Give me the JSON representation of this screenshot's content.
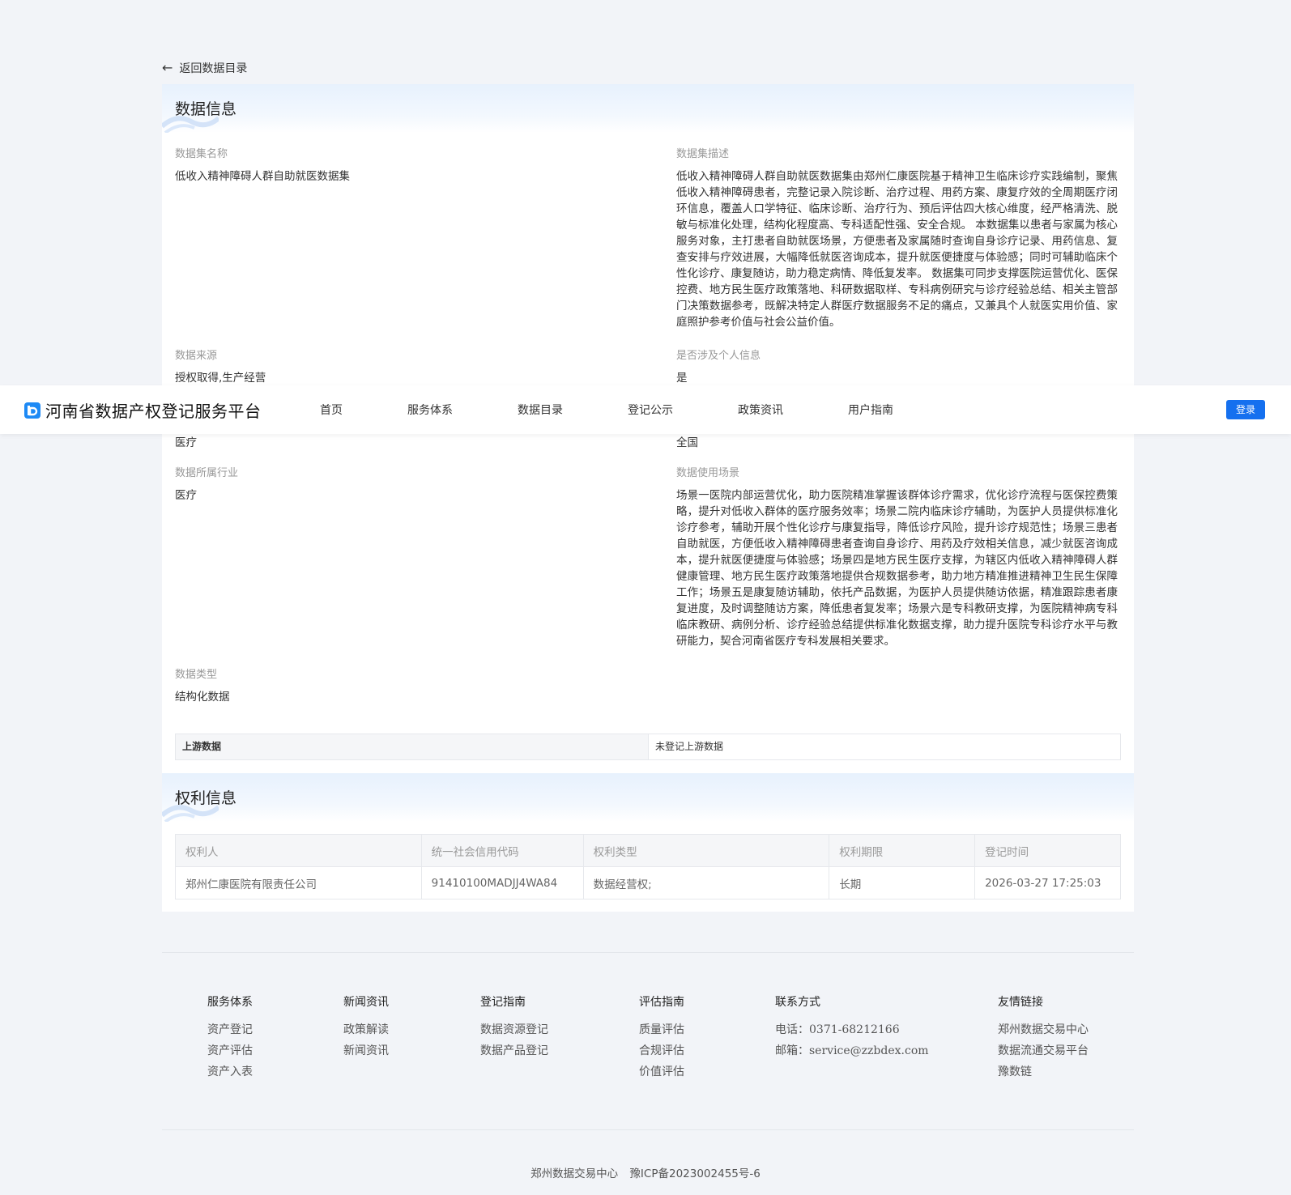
{
  "back": {
    "label": "返回数据目录"
  },
  "data_info": {
    "title": "数据信息",
    "dataset_name": {
      "label": "数据集名称",
      "value": "低收入精神障碍人群自助就医数据集"
    },
    "dataset_desc": {
      "label": "数据集描述",
      "value": "低收入精神障碍人群自助就医数据集由郑州仁康医院基于精神卫生临床诊疗实践编制，聚焦低收入精神障碍患者，完整记录入院诊断、治疗过程、用药方案、康复疗效的全周期医疗闭环信息，覆盖人口学特征、临床诊断、治疗行为、预后评估四大核心维度，经严格清洗、脱敏与标准化处理，结构化程度高、专科适配性强、安全合规。 本数据集以患者与家属为核心服务对象，主打患者自助就医场景，方便患者及家属随时查询自身诊疗记录、用药信息、复查安排与疗效进展，大幅降低就医咨询成本，提升就医便捷度与体验感；同时可辅助临床个性化诊疗、康复随访，助力稳定病情、降低复发率。 数据集可同步支撑医院运营优化、医保控费、地方民生医疗政策落地、科研数据取样、专科病例研究与诊疗经验总结、相关主管部门决策数据参考，既解决特定人群医疗数据服务不足的痛点，又兼具个人就医实用价值、家庭照护参考价值与社会公益价值。"
    },
    "data_source": {
      "label": "数据来源",
      "value": "授权取得,生产经营"
    },
    "personal_info": {
      "label": "是否涉及个人信息",
      "value": "是"
    },
    "domain": {
      "value": "医疗"
    },
    "region": {
      "value": "全国"
    },
    "industry": {
      "label": "数据所属行业",
      "value": "医疗"
    },
    "scenario": {
      "label": "数据使用场景",
      "value": "场景一医院内部运营优化，助力医院精准掌握该群体诊疗需求，优化诊疗流程与医保控费策略，提升对低收入群体的医疗服务效率；场景二院内临床诊疗辅助，为医护人员提供标准化诊疗参考，辅助开展个性化诊疗与康复指导，降低诊疗风险，提升诊疗规范性；场景三患者自助就医，方便低收入精神障碍患者查询自身诊疗、用药及疗效相关信息，减少就医咨询成本，提升就医便捷度与体验感；场景四是地方民生医疗支撑，为辖区内低收入精神障碍人群健康管理、地方民生医疗政策落地提供合规数据参考，助力地方精准推进精神卫生民生保障工作；场景五是康复随访辅助，依托产品数据，为医护人员提供随访依据，精准跟踪患者康复进度，及时调整随访方案，降低患者复发率；场景六是专科教研支撑，为医院精神病专科临床教研、病例分析、诊疗经验总结提供标准化数据支撑，助力提升医院专科诊疗水平与教研能力，契合河南省医疗专科发展相关要求。"
    },
    "data_type": {
      "label": "数据类型",
      "value": "结构化数据"
    },
    "upstream": {
      "label": "上游数据",
      "value": "未登记上游数据"
    }
  },
  "rights_info": {
    "title": "权利信息",
    "columns": [
      "权利人",
      "统一社会信用代码",
      "权利类型",
      "权利期限",
      "登记时间"
    ],
    "rows": [
      [
        "郑州仁康医院有限责任公司",
        "91410100MADJJ4WA84",
        "数据经营权;",
        "长期",
        "2026-03-27 17:25:03"
      ]
    ]
  },
  "navbar": {
    "brand": "河南省数据产权登记服务平台",
    "items": [
      "首页",
      "服务体系",
      "数据目录",
      "登记公示",
      "政策资讯",
      "用户指南"
    ],
    "login": "登录",
    "accent": "#1570ef"
  },
  "footer": {
    "services": {
      "title": "服务体系",
      "items": [
        "资产登记",
        "资产评估",
        "资产入表"
      ]
    },
    "news": {
      "title": "新闻资讯",
      "items": [
        "政策解读",
        "新闻资讯"
      ]
    },
    "registration": {
      "title": "登记指南",
      "items": [
        "数据资源登记",
        "数据产品登记"
      ]
    },
    "evaluation": {
      "title": "评估指南",
      "items": [
        "质量评估",
        "合规评估",
        "价值评估"
      ]
    },
    "contact": {
      "title": "联系方式",
      "phone": "电话：0371-68212166",
      "email": "邮箱：service@zzbdex.com"
    },
    "links": {
      "title": "友情链接",
      "items": [
        "郑州数据交易中心",
        "数据流通交易平台",
        "豫数链"
      ]
    },
    "copyright_org": "郑州数据交易中心",
    "icp": "豫ICP备2023002455号-6"
  }
}
